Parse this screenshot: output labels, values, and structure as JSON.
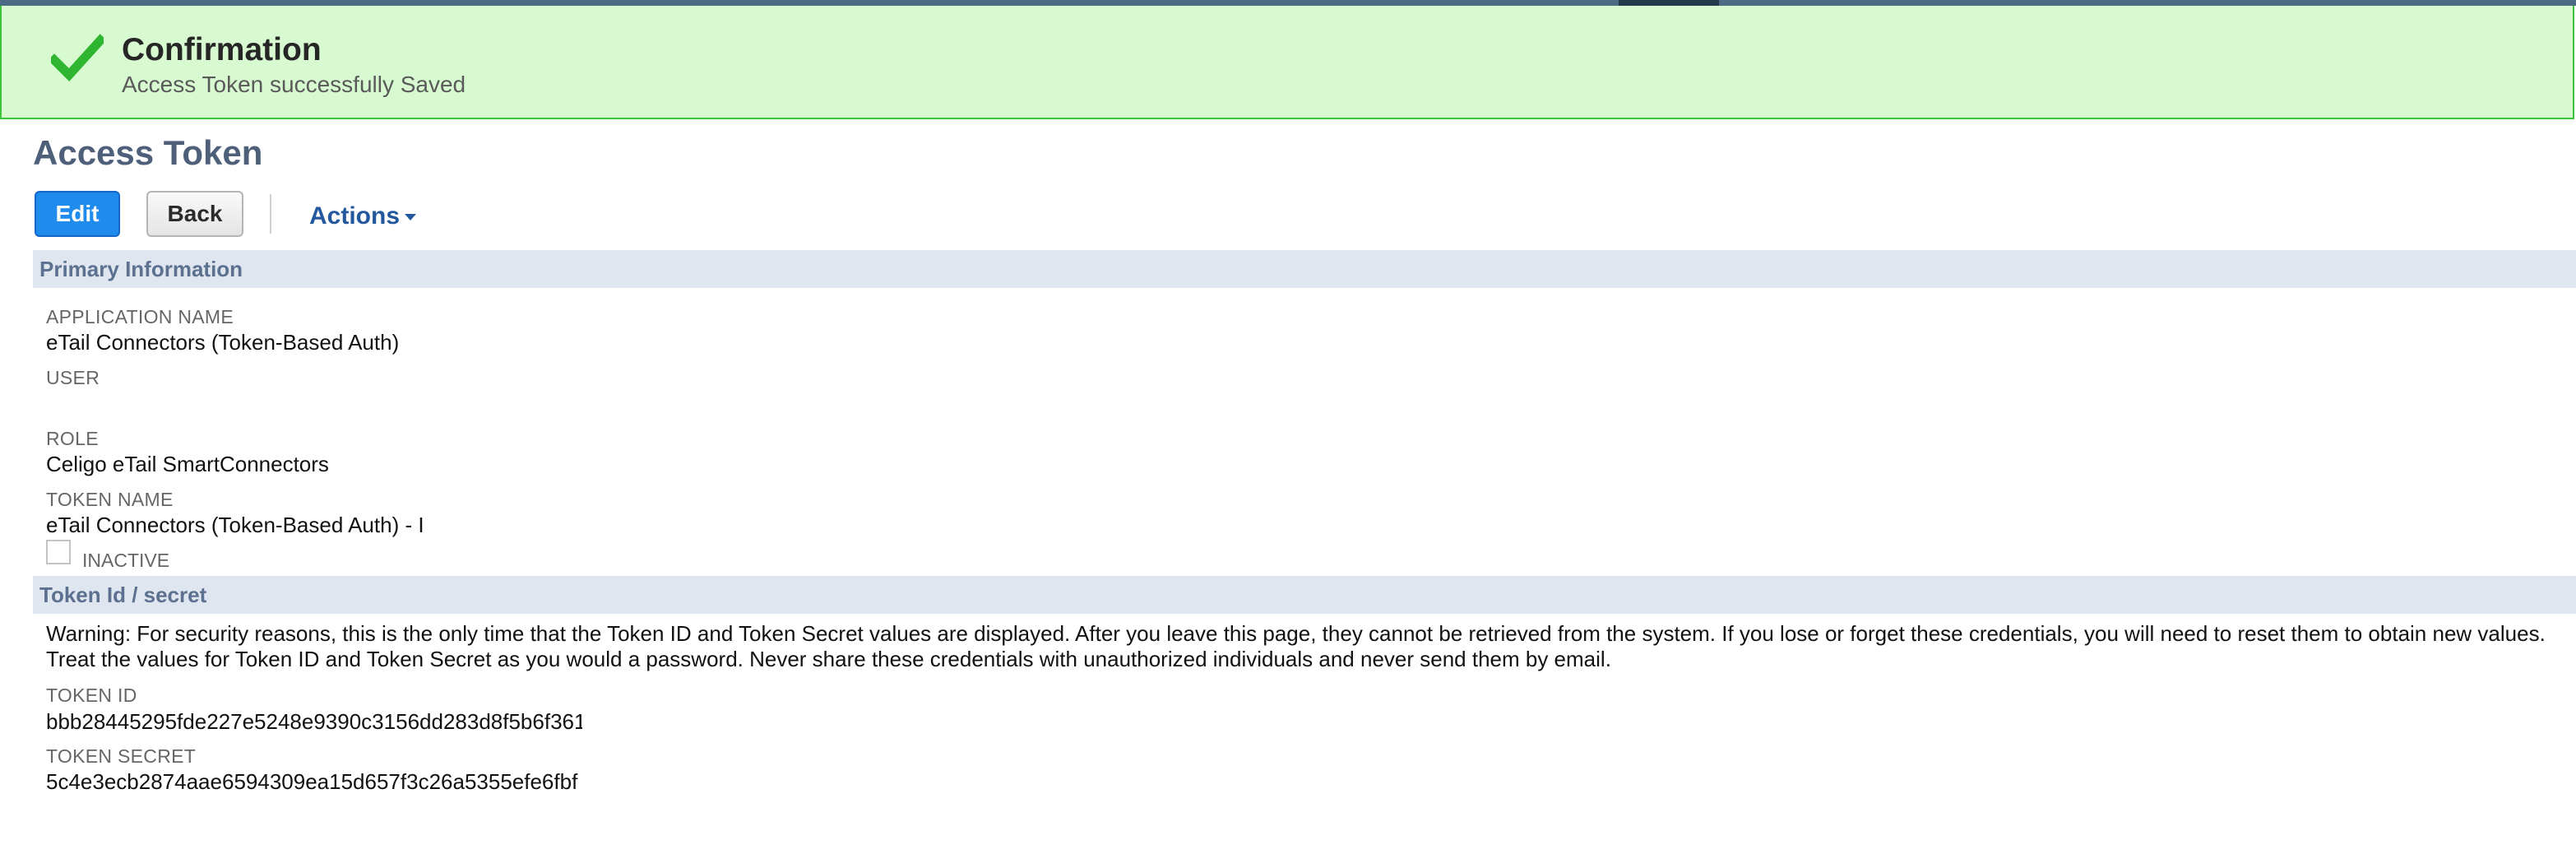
{
  "confirmation": {
    "title": "Confirmation",
    "message": "Access Token successfully Saved",
    "icon": "checkmark-icon",
    "accent_color": "#3cc43c"
  },
  "page": {
    "title": "Access Token"
  },
  "toolbar": {
    "edit_label": "Edit",
    "back_label": "Back",
    "actions_label": "Actions"
  },
  "primary_info": {
    "section_title": "Primary Information",
    "application_name_label": "APPLICATION NAME",
    "application_name_value": "eTail Connectors (Token-Based Auth)",
    "user_label": "USER",
    "user_value": "",
    "role_label": "ROLE",
    "role_value": "Celigo eTail SmartConnectors",
    "token_name_label": "TOKEN NAME",
    "token_name_value": "eTail Connectors (Token-Based Auth) - I",
    "inactive_label": "INACTIVE",
    "inactive_checked": false
  },
  "token_secret": {
    "section_title": "Token Id / secret",
    "warning": "Warning: For security reasons, this is the only time that the Token ID and Token Secret values are displayed. After you leave this page, they cannot be retrieved from the system. If you lose or forget these credentials, you will need to reset them to obtain new values. Treat the values for Token ID and Token Secret as you would a password. Never share these credentials with unauthorized individuals and never send them by email.",
    "token_id_label": "TOKEN ID",
    "token_id_value": "bbb28445295fde227e5248e9390c3156dd283d8f5b6f361",
    "token_secret_label": "TOKEN SECRET",
    "token_secret_value": "5c4e3ecb2874aae6594309ea15d657f3c26a5355efe6fbf"
  }
}
